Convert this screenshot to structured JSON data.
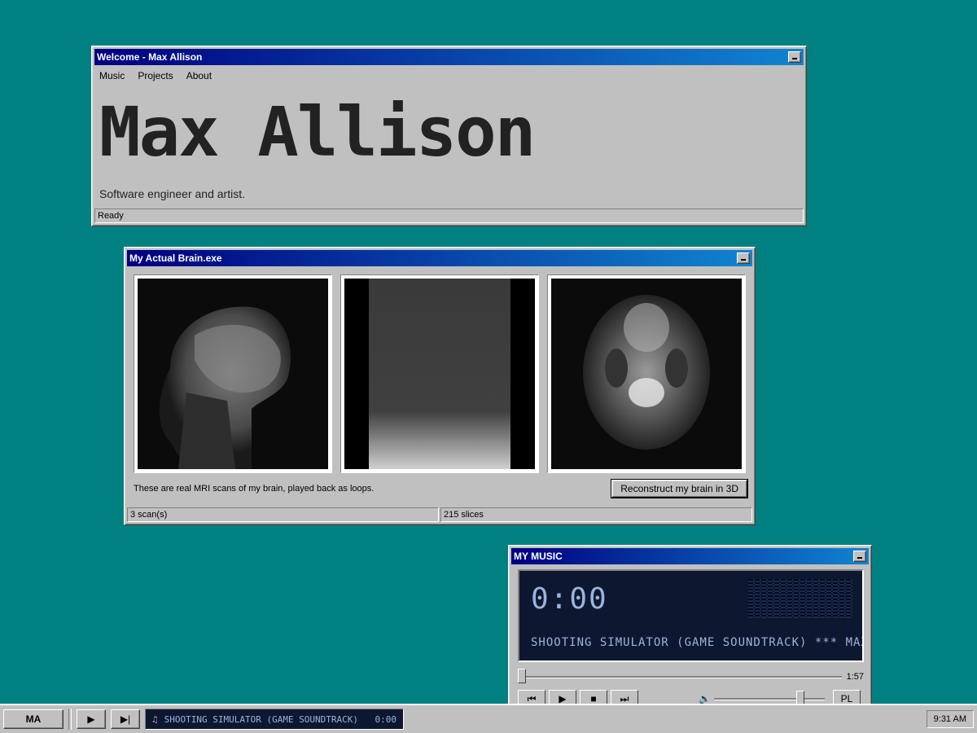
{
  "welcome_window": {
    "title": "Welcome - Max Allison",
    "menu": [
      {
        "label": "Music"
      },
      {
        "label": "Projects"
      },
      {
        "label": "About"
      }
    ],
    "heading": "Max Allison",
    "tagline": "Software engineer and artist.",
    "status": "Ready"
  },
  "brain_window": {
    "title": "My Actual Brain.exe",
    "caption": "These are real MRI scans of my brain, played back as loops.",
    "button_label": "Reconstruct my brain in 3D",
    "status_left": "3 scan(s)",
    "status_right": "215 slices"
  },
  "music_window": {
    "title": "MY MUSIC",
    "time": "0:00",
    "marquee": "SHOOTING SIMULATOR (GAME SOUNDTRACK)  ***  MAX ALL",
    "duration": "1:57",
    "playlist_label": "PL",
    "seek_fraction": 0,
    "volume_fraction": 0.8
  },
  "taskbar": {
    "start_label": "MA",
    "now_playing_title": "SHOOTING SIMULATOR (GAME SOUNDTRACK)",
    "now_playing_time": "0:00",
    "clock": "9:31 AM"
  },
  "icons": [
    "minimize-icon",
    "play-icon",
    "next-icon",
    "prev-icon",
    "stop-icon",
    "music-note-icon",
    "volume-icon"
  ],
  "colors": {
    "desktop": "#008080",
    "title_start": "#000080",
    "title_end": "#1084d0",
    "lcd_bg": "#0d1830",
    "lcd_text": "#9ab4e0"
  }
}
